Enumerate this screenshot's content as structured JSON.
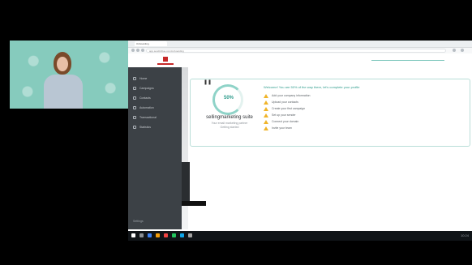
{
  "browser": {
    "tab_title": "Onboarding",
    "address": "app.sendinblue.com/onboarding"
  },
  "app": {
    "brand_name": "sellingmarketing suite",
    "brand_tagline": "Your email marketing partner",
    "brand_tagline2": "Getting started",
    "progress_label": "50%",
    "checklist_title": "Welcome! You are 50% of the way there, let's complete your profile",
    "checklist": [
      "Add your company information",
      "Upload your contacts",
      "Create your first campaign",
      "Set up your sender",
      "Connect your domain",
      "Invite your team"
    ]
  },
  "sidebar": {
    "items": [
      {
        "label": "Home",
        "icon": "home-icon"
      },
      {
        "label": "Campaigns",
        "icon": "campaign-icon"
      },
      {
        "label": "Contacts",
        "icon": "contacts-icon"
      },
      {
        "label": "Automation",
        "icon": "automation-icon"
      },
      {
        "label": "Transactional",
        "icon": "transactional-icon"
      },
      {
        "label": "Statistics",
        "icon": "statistics-icon"
      }
    ],
    "footer": "Settings"
  },
  "taskbar": {
    "clock": "10:24"
  },
  "colors": {
    "accent": "#2e9c8c",
    "sidebar_bg": "#3c4146",
    "warning": "#f0b429",
    "brand_red": "#c62828"
  }
}
